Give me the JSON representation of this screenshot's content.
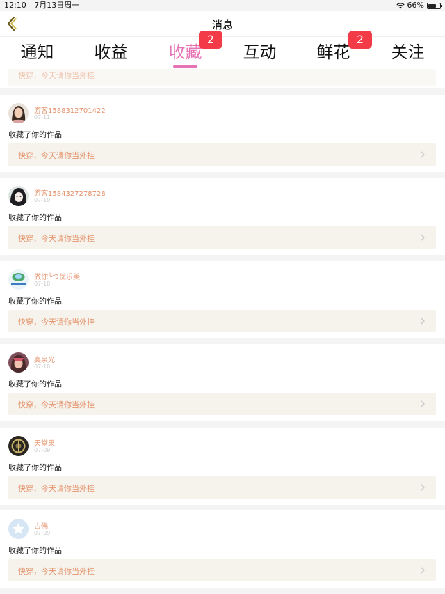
{
  "status_bar": {
    "time": "12:10",
    "date": "7月13日周一",
    "battery_percent": "66%",
    "battery_level": 0.66
  },
  "nav": {
    "title": "消息",
    "back_icon": "chevron-left-icon"
  },
  "tabs": [
    {
      "label": "通知",
      "badge": ""
    },
    {
      "label": "收益",
      "badge": ""
    },
    {
      "label": "收藏",
      "badge": "2",
      "active": true
    },
    {
      "label": "互动",
      "badge": ""
    },
    {
      "label": "鲜花",
      "badge": "2"
    },
    {
      "label": "关注",
      "badge": ""
    }
  ],
  "colors": {
    "accent": "#e673b4",
    "badge": "#f23b47",
    "username": "#e4926a",
    "link_bg": "#f5f3ec"
  },
  "partial_item": {
    "link_text": "快穿，今天请你当外挂"
  },
  "items": [
    {
      "username": "游客1588312701422",
      "date": "07-11",
      "action": "收藏了你的作品",
      "link_text": "快穿，今天请你当外挂",
      "avatar": "photo-woman"
    },
    {
      "username": "游客1584327278728",
      "date": "07-10",
      "action": "收藏了你的作品",
      "link_text": "快穿，今天请你当外挂",
      "avatar": "anime-girl"
    },
    {
      "username": "做你╰つ优乐美",
      "date": "07-10",
      "action": "收藏了你的作品",
      "link_text": "快穿，今天请你当外挂",
      "avatar": "green-logo"
    },
    {
      "username": "奥泉光",
      "date": "07-10",
      "action": "收藏了你的作品",
      "link_text": "快穿，今天请你当外挂",
      "avatar": "anime-character"
    },
    {
      "username": "天堂果",
      "date": "07-09",
      "action": "收藏了你的作品",
      "link_text": "快穿，今天请你当外挂",
      "avatar": "dark-scene"
    },
    {
      "username": "古佛",
      "date": "07-09",
      "action": "收藏了你的作品",
      "link_text": "快穿，今天请你当外挂",
      "avatar": "default-star"
    }
  ]
}
